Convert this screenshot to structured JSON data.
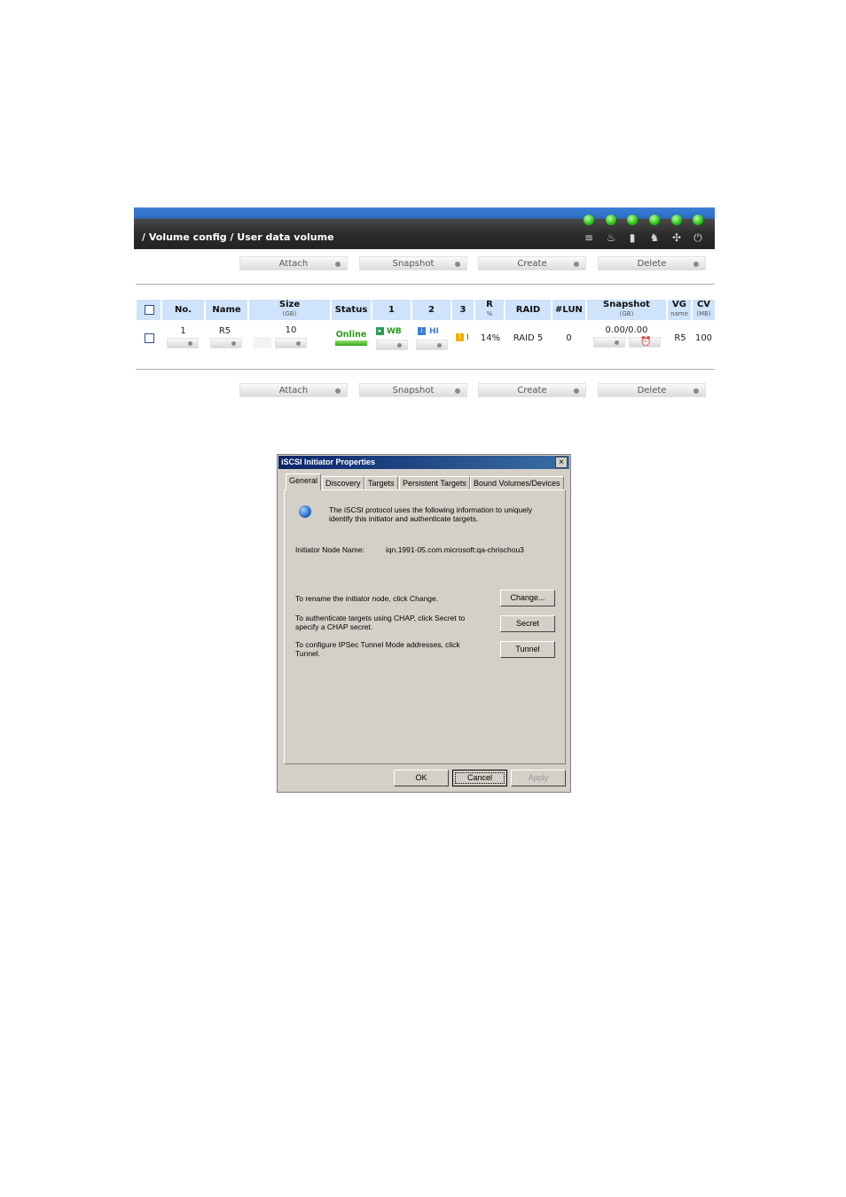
{
  "panel": {
    "breadcrumb": "/ Volume config / User data volume",
    "status_icons": [
      "disk-icon",
      "thermometer-icon",
      "battery-icon",
      "voltage-icon",
      "fan-icon",
      "power-icon"
    ],
    "status_icon_glyphs": [
      "≡",
      "♨",
      "▮",
      "♞",
      "✣",
      "⏻"
    ],
    "accent_color": "#2a6cc4",
    "actions": [
      "Attach",
      "Snapshot",
      "Create",
      "Delete"
    ],
    "columns": {
      "no": "No.",
      "name": "Name",
      "size": "Size",
      "size_unit": "(GB)",
      "status": "Status",
      "c1": "1",
      "c2": "2",
      "c3": "3",
      "r": "R",
      "r_unit": "%",
      "raid": "RAID",
      "lun": "#LUN",
      "snapshot": "Snapshot",
      "snapshot_unit": "(GB)",
      "vg": "VG",
      "vg_unit": "name",
      "cv": "CV",
      "cv_unit": "(MB)"
    },
    "rows": [
      {
        "no": "1",
        "name": "R5",
        "size": "10",
        "status": "Online",
        "c1_badge": "WB",
        "c2_badge": "HI",
        "c3_badge": "I",
        "r": "14%",
        "raid": "RAID 5",
        "lun": "0",
        "snapshot": "0.00/0.00",
        "vg": "R5",
        "cv": "100"
      }
    ]
  },
  "dialog": {
    "title": "iSCSI Initiator Properties",
    "close": "×",
    "tabs": [
      "General",
      "Discovery",
      "Targets",
      "Persistent Targets",
      "Bound Volumes/Devices"
    ],
    "intro_line1": "The iSCSI protocol uses the following information to uniquely",
    "intro_line2": "identify this initiator and authenticate targets.",
    "node_label": "Initiator Node Name:",
    "node_value": "iqn.1991-05.com.microsoft:qa-chrischou3",
    "rename_text": "To rename the initiator node, click Change.",
    "chap_line1": "To authenticate targets using CHAP, click Secret to",
    "chap_line2": "specify a CHAP secret.",
    "ipsec_line1": "To configure IPSec Tunnel Mode addresses, click",
    "ipsec_line2": "Tunnel.",
    "change_label": "Change...",
    "secret_label": "Secret",
    "tunnel_label": "Tunnel",
    "ok_label": "OK",
    "cancel_label": "Cancel",
    "apply_label": "Apply"
  }
}
